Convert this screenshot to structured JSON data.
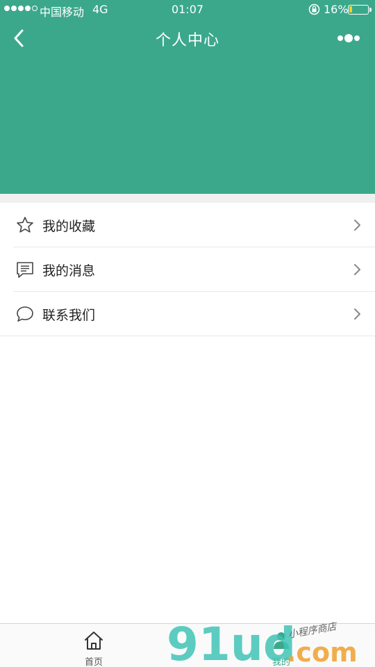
{
  "status_bar": {
    "carrier": "中国移动",
    "network": "4G",
    "time": "01:07",
    "battery": "16%",
    "battery_level": 0.16,
    "signal_bars_filled": 4,
    "signal_bars_total": 5
  },
  "nav": {
    "title": "个人中心",
    "back_icon": "chevron-left-icon",
    "more_icon": "more-dots-icon"
  },
  "colors": {
    "header": "#3ba88c",
    "tab_active": "#3ba88c",
    "battery_fill": "#f5d31e"
  },
  "menu": {
    "items": [
      {
        "label": "我的收藏",
        "icon": "star-icon"
      },
      {
        "label": "我的消息",
        "icon": "message-icon"
      },
      {
        "label": "联系我们",
        "icon": "chat-bubble-icon"
      }
    ]
  },
  "tabbar": {
    "tabs": [
      {
        "label": "首页",
        "icon": "home-icon",
        "active": false
      },
      {
        "label": "我的",
        "icon": "user-icon",
        "active": true
      }
    ]
  },
  "watermark": {
    "brand": "91ud",
    "suffix": ".com",
    "tagline": "小程序商店"
  }
}
